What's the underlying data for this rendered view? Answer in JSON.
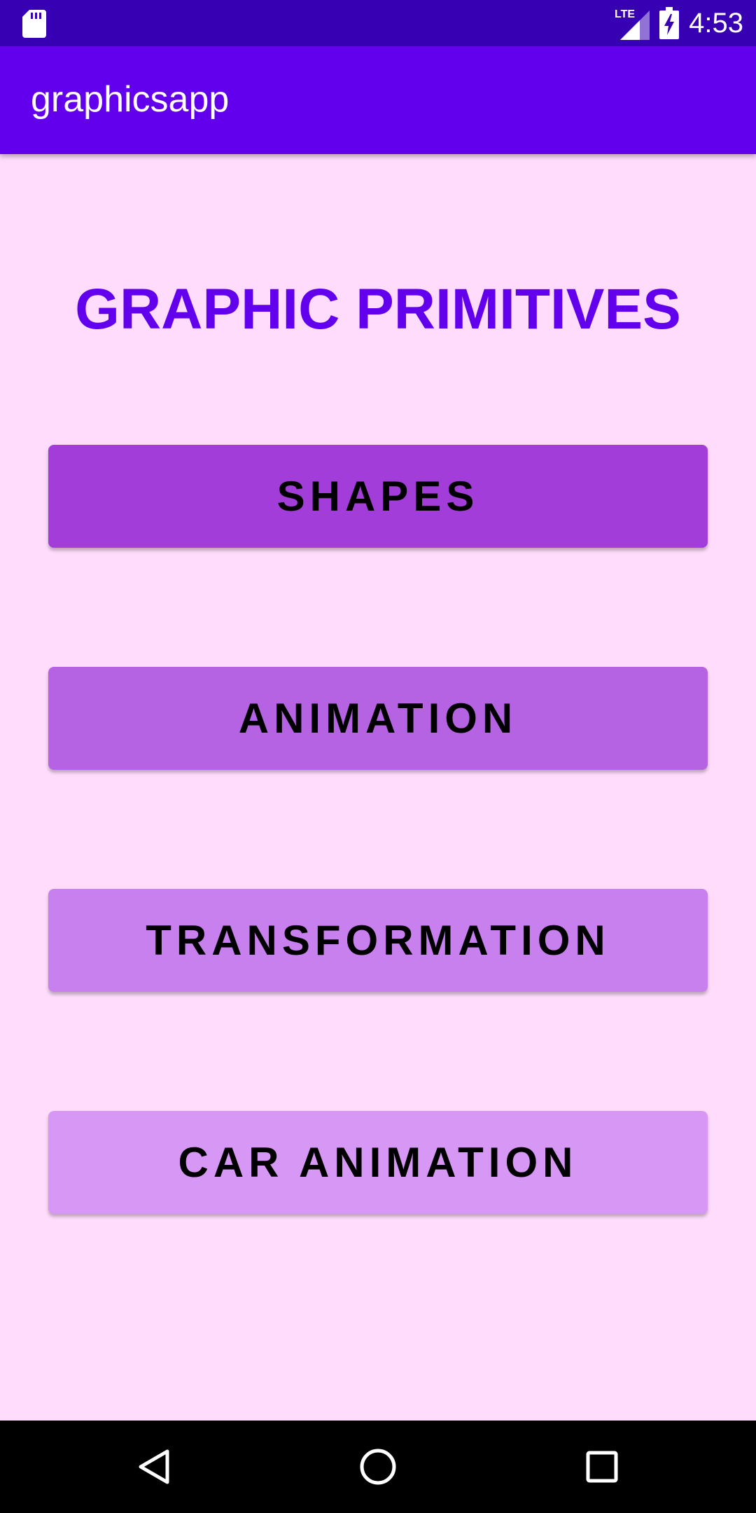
{
  "status_bar": {
    "time": "4:53",
    "network_label": "LTE",
    "sd_icon": "sd-card-icon",
    "signal_icon": "signal-icon",
    "battery_icon": "battery-charging-icon"
  },
  "app_bar": {
    "title": "graphicsapp"
  },
  "main": {
    "heading": "GRAPHIC PRIMITIVES",
    "buttons": [
      {
        "label": "SHAPES",
        "color": "#A23DDA"
      },
      {
        "label": "ANIMATION",
        "color": "#B563E3"
      },
      {
        "label": "TRANSFORMATION",
        "color": "#C880EE"
      },
      {
        "label": "CAR ANIMATION",
        "color": "#D797F4"
      }
    ]
  },
  "nav_bar": {
    "back_icon": "back-triangle-icon",
    "home_icon": "home-circle-icon",
    "recents_icon": "recents-square-icon"
  },
  "colors": {
    "status_bar": "#3700B3",
    "app_bar": "#6200EE",
    "background": "#FFDCFC",
    "heading": "#6200EE"
  }
}
